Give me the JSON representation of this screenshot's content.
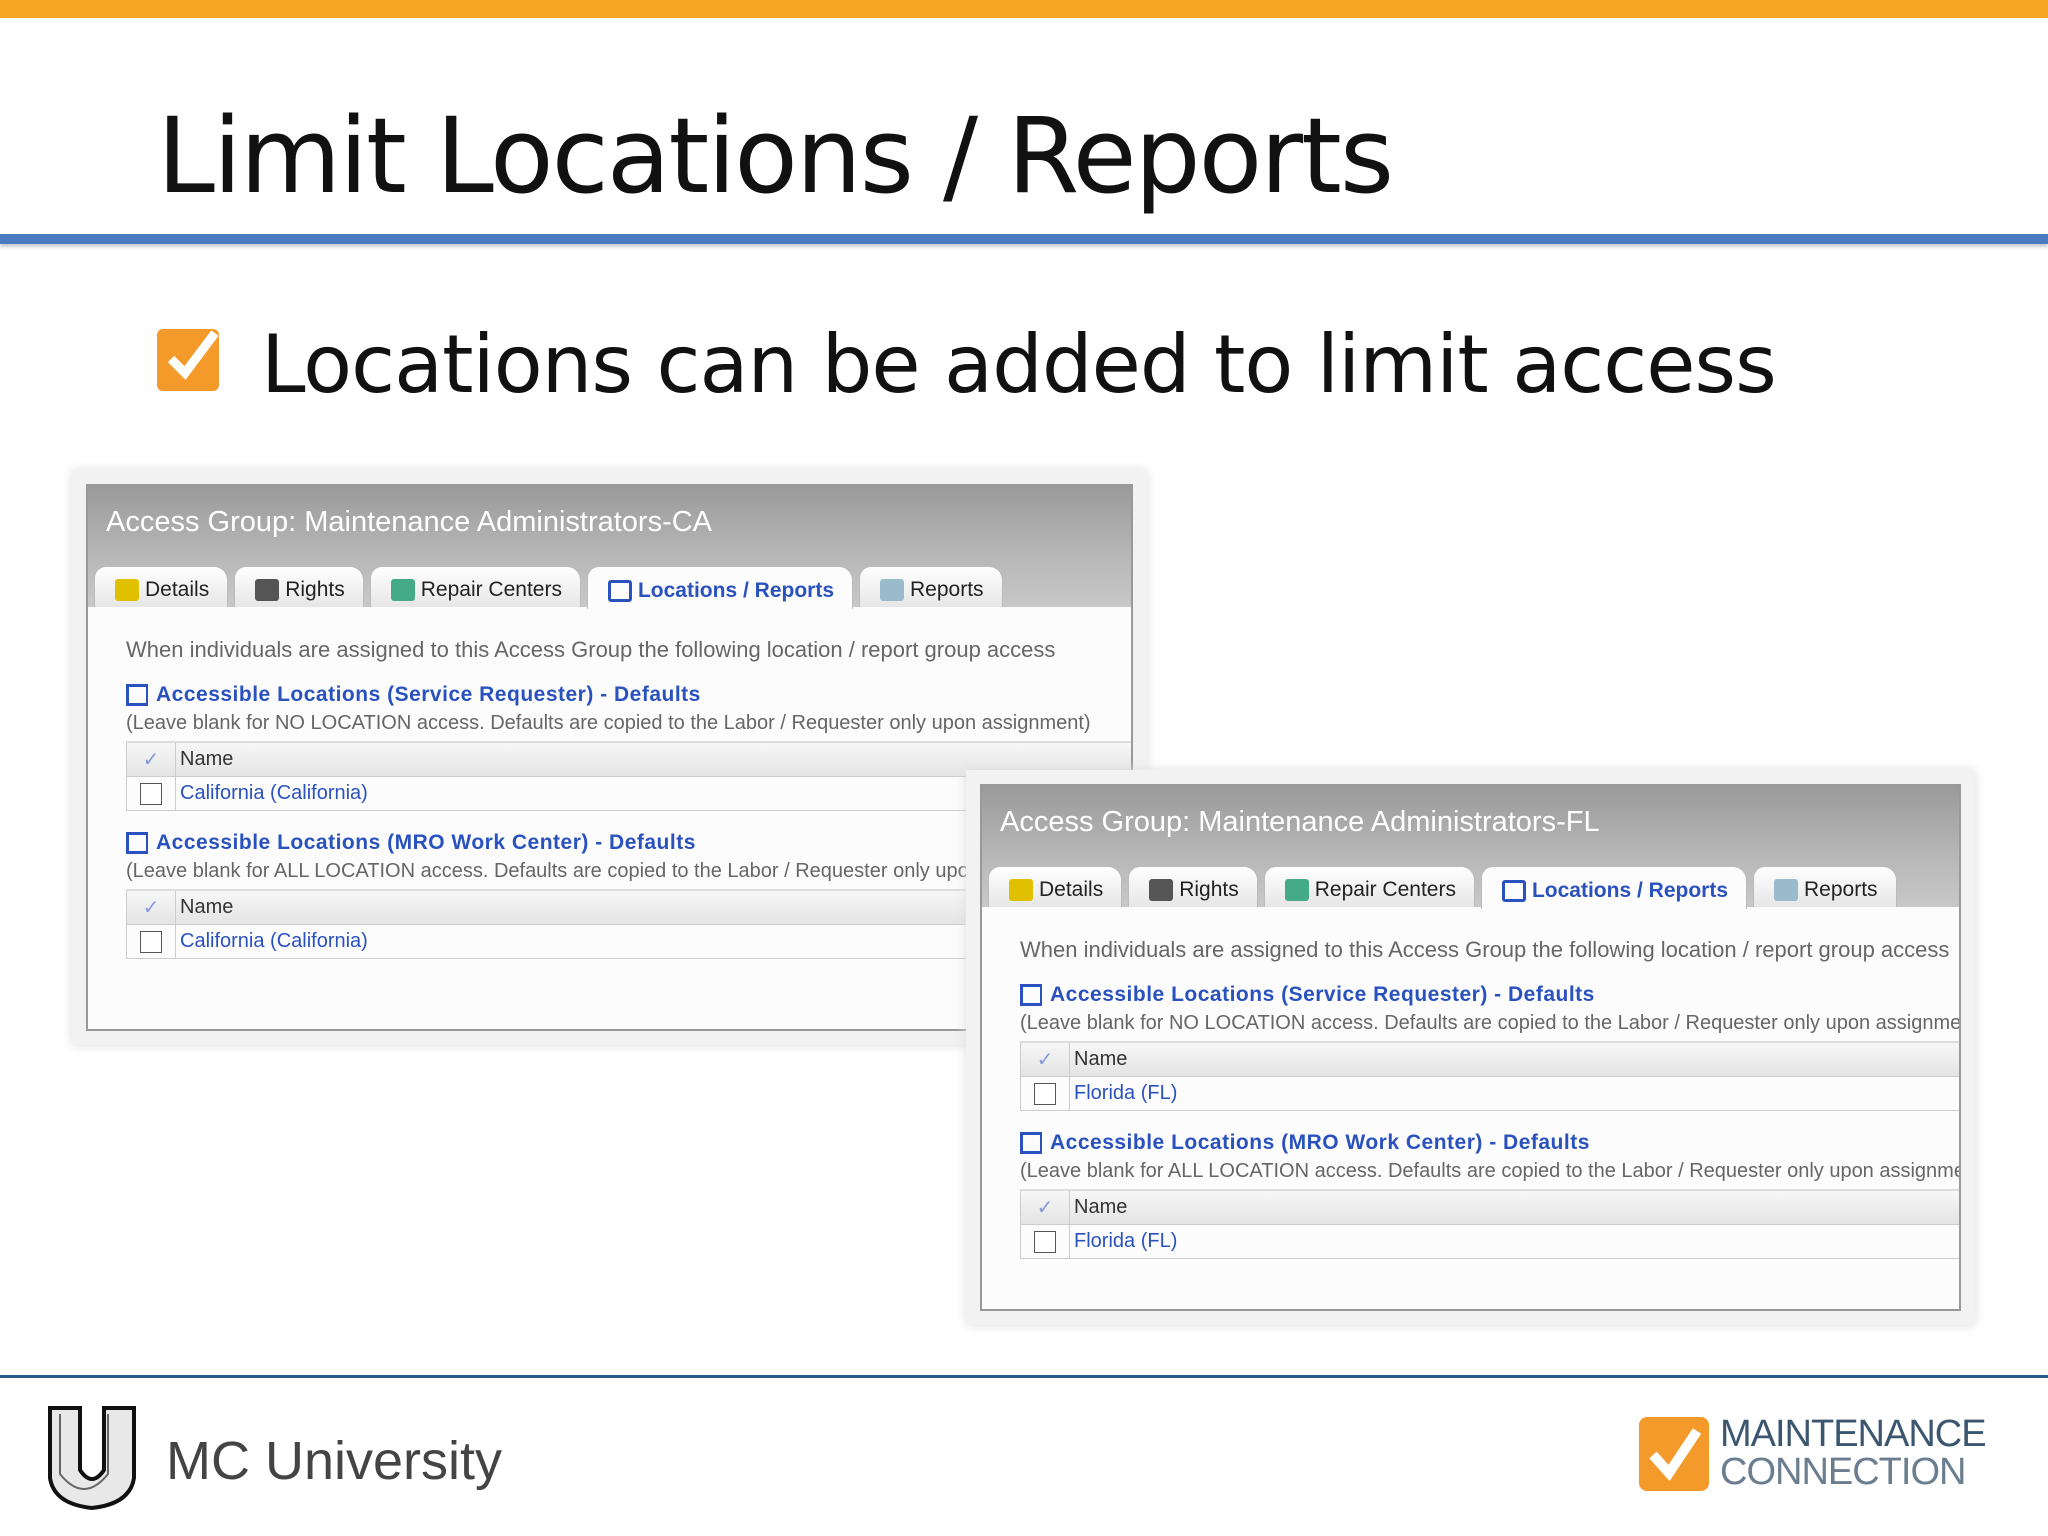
{
  "slide": {
    "title": "Limit Locations / Reports",
    "bullet": "Locations can be added to limit access"
  },
  "panels": [
    {
      "title": "Access Group: Maintenance Administrators-CA",
      "tabs": [
        "Details",
        "Rights",
        "Repair Centers",
        "Locations / Reports",
        "Reports"
      ],
      "active_tab": 3,
      "intro": "When individuals are assigned to this Access Group the following location / report group access",
      "sections": [
        {
          "link": "Accessible Locations (Service Requester) - Defaults",
          "note": "(Leave blank for NO LOCATION access. Defaults are copied to the Labor / Requester only upon assignment)",
          "col": "Name",
          "rows": [
            "California (California)"
          ]
        },
        {
          "link": "Accessible Locations (MRO Work Center) - Defaults",
          "note": "(Leave blank for ALL LOCATION access. Defaults are copied to the Labor / Requester only upon assignment)",
          "col": "Name",
          "rows": [
            "California (California)"
          ]
        }
      ]
    },
    {
      "title": "Access Group: Maintenance Administrators-FL",
      "tabs": [
        "Details",
        "Rights",
        "Repair Centers",
        "Locations / Reports",
        "Reports"
      ],
      "active_tab": 3,
      "intro": "When individuals are assigned to this Access Group the following location / report group access",
      "sections": [
        {
          "link": "Accessible Locations (Service Requester) - Defaults",
          "note": "(Leave blank for NO LOCATION access. Defaults are copied to the Labor / Requester only upon assignment)",
          "col": "Name",
          "rows": [
            "Florida (FL)"
          ]
        },
        {
          "link": "Accessible Locations (MRO Work Center) - Defaults",
          "note": "(Leave blank for ALL LOCATION access. Defaults are copied to the Labor / Requester only upon assignment)",
          "col": "Name",
          "rows": [
            "Florida (FL)"
          ]
        }
      ]
    }
  ],
  "footer": {
    "university": "MC University",
    "brand_line1": "MAINTENANCE",
    "brand_line2": "CONNECTION"
  },
  "colors": {
    "accent": "#f5a623",
    "rule": "#4a7bc0",
    "link": "#2a52be"
  }
}
